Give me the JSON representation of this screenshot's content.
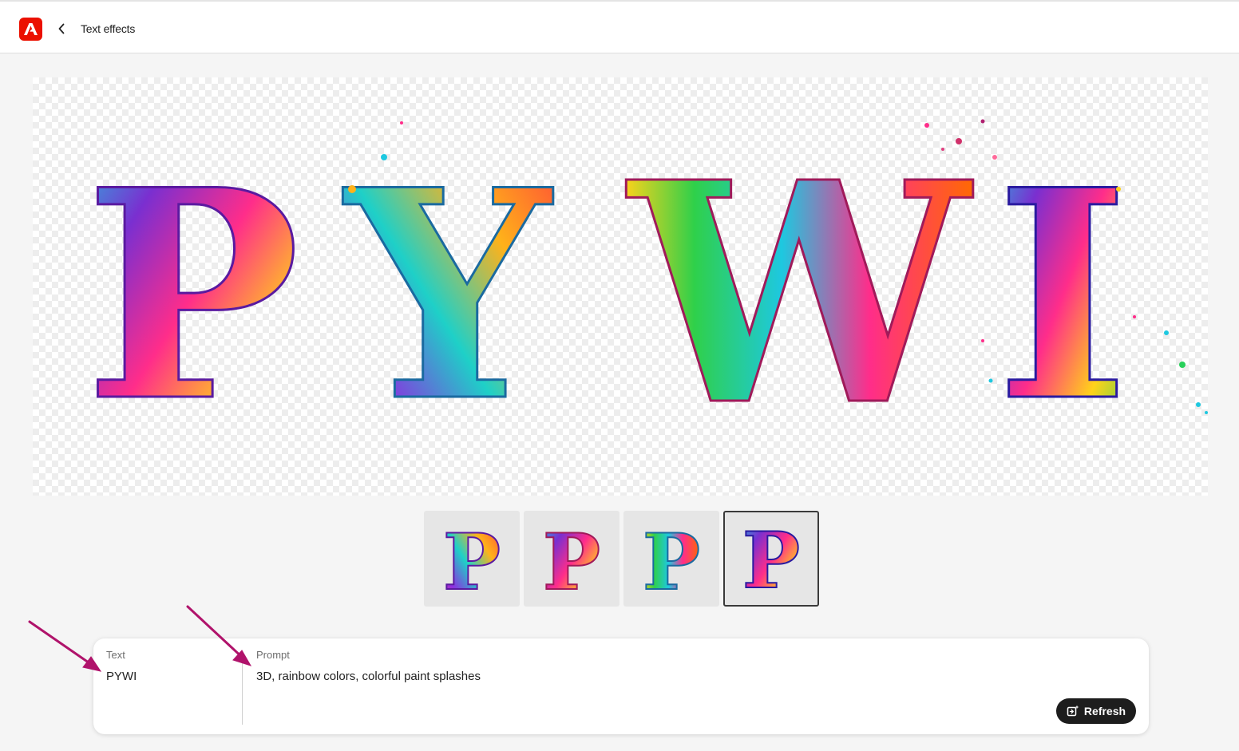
{
  "header": {
    "app_logo_icon": "adobe-express-logo",
    "back_icon": "chevron-left-icon",
    "title": "Text effects"
  },
  "preview": {
    "letters": [
      "P",
      "Y",
      "W",
      "I"
    ]
  },
  "thumbnails": [
    {
      "letter": "P",
      "selected": false
    },
    {
      "letter": "P",
      "selected": false
    },
    {
      "letter": "P",
      "selected": false
    },
    {
      "letter": "P",
      "selected": true
    }
  ],
  "form": {
    "text_label": "Text",
    "text_value": "PYWI",
    "prompt_label": "Prompt",
    "prompt_value": "3D, rainbow colors, colorful paint splashes",
    "refresh_label": "Refresh",
    "refresh_icon": "refresh-sparkle-icon"
  },
  "annotations": {
    "arrow_color": "#b0136b"
  },
  "colors": {
    "brand": "#eb1000",
    "button_bg": "#1d1d1d"
  }
}
